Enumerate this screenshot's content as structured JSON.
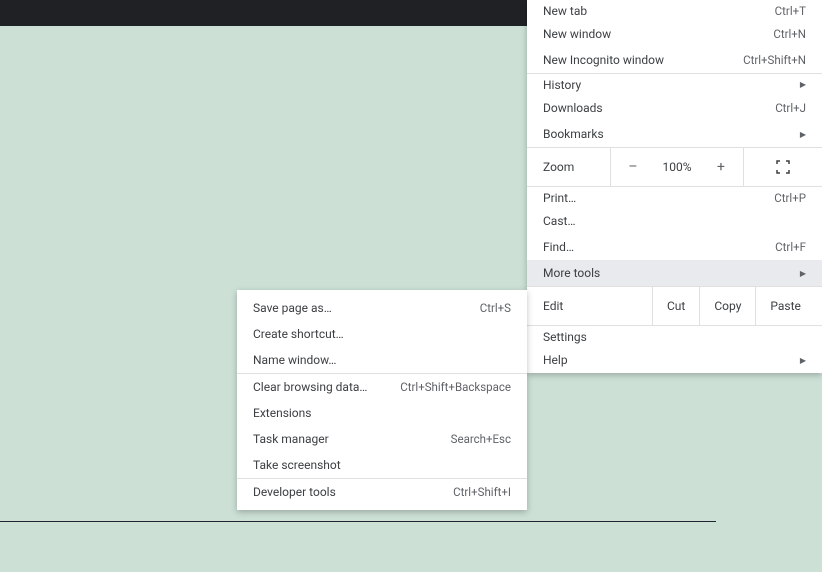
{
  "mainMenu": {
    "newTab": {
      "label": "New tab",
      "shortcut": "Ctrl+T"
    },
    "newWindow": {
      "label": "New window",
      "shortcut": "Ctrl+N"
    },
    "newIncognito": {
      "label": "New Incognito window",
      "shortcut": "Ctrl+Shift+N"
    },
    "history": {
      "label": "History"
    },
    "downloads": {
      "label": "Downloads",
      "shortcut": "Ctrl+J"
    },
    "bookmarks": {
      "label": "Bookmarks"
    },
    "zoom": {
      "label": "Zoom",
      "minus": "–",
      "pct": "100%",
      "plus": "+"
    },
    "print": {
      "label": "Print…",
      "shortcut": "Ctrl+P"
    },
    "cast": {
      "label": "Cast…"
    },
    "find": {
      "label": "Find…",
      "shortcut": "Ctrl+F"
    },
    "moreTools": {
      "label": "More tools"
    },
    "edit": {
      "label": "Edit",
      "cut": "Cut",
      "copy": "Copy",
      "paste": "Paste"
    },
    "settings": {
      "label": "Settings"
    },
    "help": {
      "label": "Help"
    }
  },
  "submenu": {
    "savePage": {
      "label": "Save page as…",
      "shortcut": "Ctrl+S"
    },
    "createShortcut": {
      "label": "Create shortcut…"
    },
    "nameWindow": {
      "label": "Name window…"
    },
    "clearBrowsing": {
      "label": "Clear browsing data…",
      "shortcut": "Ctrl+Shift+Backspace"
    },
    "extensions": {
      "label": "Extensions"
    },
    "taskManager": {
      "label": "Task manager",
      "shortcut": "Search+Esc"
    },
    "takeScreenshot": {
      "label": "Take screenshot"
    },
    "devTools": {
      "label": "Developer tools",
      "shortcut": "Ctrl+Shift+I"
    }
  }
}
